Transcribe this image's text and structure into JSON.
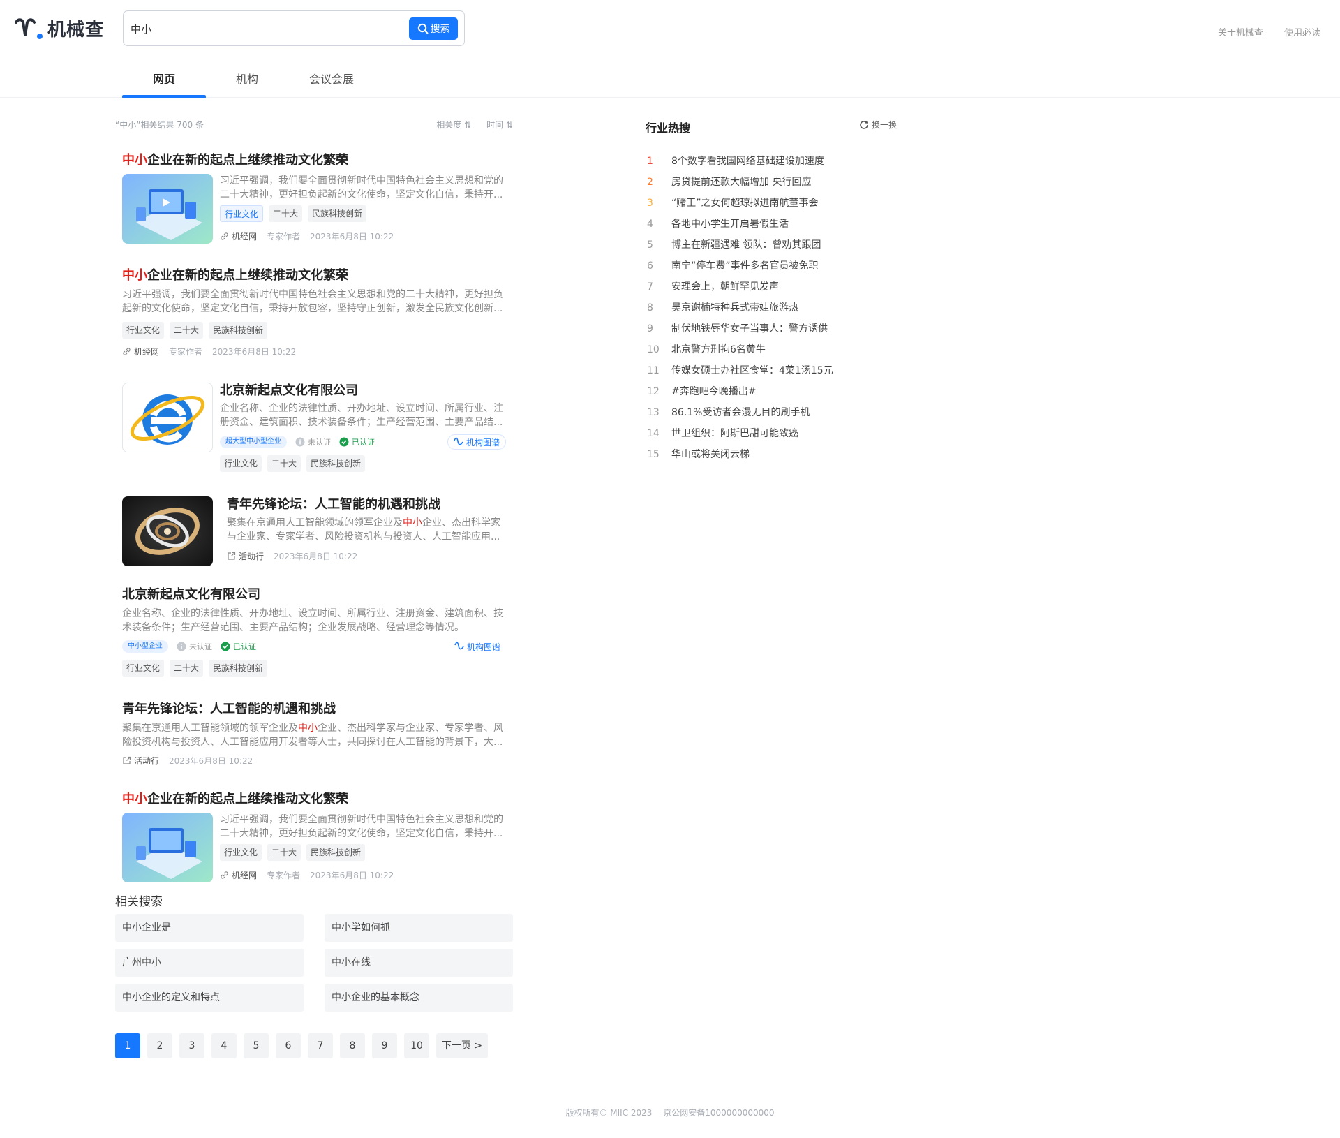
{
  "brand": {
    "name": "机械查"
  },
  "search": {
    "value": "中小",
    "button": "搜索"
  },
  "top_links": [
    "关于机械查",
    "使用必读"
  ],
  "tabs": [
    "网页",
    "机构",
    "会议会展"
  ],
  "results_meta": {
    "summary": "“中小”相关结果 700 条",
    "sort_relevance": "相关度",
    "sort_time": "时间"
  },
  "results": {
    "r1": {
      "title_hl": "中小",
      "title_rest": "企业在新的起点上继续推动文化繁荣",
      "desc": "习近平强调，我们要全面贯彻新时代中国特色社会主义思想和党的二十大精神，更好担负起新的文化使命，坚定文化自信，秉持开...",
      "tags": [
        "行业文化",
        "二十大",
        "民族科技创新"
      ],
      "source": "机经网",
      "author": "专家作者",
      "time": "2023年6月8日 10:22"
    },
    "r2": {
      "title_hl": "中小",
      "title_rest": "企业在新的起点上继续推动文化繁荣",
      "desc": "习近平强调，我们要全面贯彻新时代中国特色社会主义思想和党的二十大精神，更好担负起新的文化使命，坚定文化自信，秉持开放包容，坚持守正创新，激发全民族文化创新...",
      "tags": [
        "行业文化",
        "二十大",
        "民族科技创新"
      ],
      "source": "机经网",
      "author": "专家作者",
      "time": "2023年6月8日 10:22"
    },
    "r3": {
      "title": "北京新起点文化有限公司",
      "desc": "企业名称、企业的法律性质、开办地址、设立时间、所属行业、注册资金、建筑面积、技术装备条件；生产经营范围、主要产品结...",
      "scale": "超大型中小型企业",
      "uncert": "未认证",
      "cert": "已认证",
      "graph": "机构图谱",
      "tags": [
        "行业文化",
        "二十大",
        "民族科技创新"
      ]
    },
    "r4": {
      "title": "青年先锋论坛：人工智能的机遇和挑战",
      "desc_pre": "聚集在京通用人工智能领域的领军企业及",
      "desc_hl": "中小",
      "desc_post": "企业、杰出科学家与企业家、专家学者、风险投资机构与投资人、人工智能应用...",
      "source": "活动行",
      "time": "2023年6月8日 10:22"
    },
    "r5": {
      "title": "北京新起点文化有限公司",
      "desc": "企业名称、企业的法律性质、开办地址、设立时间、所属行业、注册资金、建筑面积、技术装备条件；生产经营范围、主要产品结构；企业发展战略、经营理念等情况。",
      "scale": "中小型企业",
      "uncert": "未认证",
      "cert": "已认证",
      "graph": "机构图谱",
      "tags": [
        "行业文化",
        "二十大",
        "民族科技创新"
      ]
    },
    "r6": {
      "title": "青年先锋论坛：人工智能的机遇和挑战",
      "desc_pre": "聚集在京通用人工智能领域的领军企业及",
      "desc_hl": "中小",
      "desc_post": "企业、杰出科学家与企业家、专家学者、风险投资机构与投资人、人工智能应用开发者等人士，共同探讨在人工智能的背景下，大...",
      "source": "活动行",
      "time": "2023年6月8日 10:22"
    },
    "r7": {
      "title_hl": "中小",
      "title_rest": "企业在新的起点上继续推动文化繁荣",
      "desc": "习近平强调，我们要全面贯彻新时代中国特色社会主义思想和党的二十大精神，更好担负起新的文化使命，坚定文化自信，秉持开...",
      "tags": [
        "行业文化",
        "二十大",
        "民族科技创新"
      ],
      "source": "机经网",
      "author": "专家作者",
      "time": "2023年6月8日 10:22"
    }
  },
  "related": {
    "title": "相关搜索",
    "items": [
      "中小企业是",
      "中小学如何抓",
      "广州中小",
      "中小在线",
      "中小企业的定义和特点",
      "中小企业的基本概念"
    ]
  },
  "pager": {
    "pages": [
      "1",
      "2",
      "3",
      "4",
      "5",
      "6",
      "7",
      "8",
      "9",
      "10"
    ],
    "next": "下一页 >",
    "current": "1"
  },
  "hot": {
    "title": "行业热搜",
    "refresh": "换一换",
    "items": [
      "8个数字看我国网络基础建设加速度",
      "房贷提前还款大幅增加 央行回应",
      "“赌王”之女何超琼拟进南航董事会",
      "各地中小学生开启暑假生活",
      "博主在新疆遇难 领队：曾劝其跟团",
      "南宁“停车费”事件多名官员被免职",
      "安理会上，朝鲜罕见发声",
      "吴京谢楠特种兵式带娃旅游热",
      "制伏地铁辱华女子当事人：警方诱供",
      "北京警方刑拘6名黄牛",
      "传媒女硕士办社区食堂：4菜1汤15元",
      "#奔跑吧今晚播出#",
      "86.1%受访者会漫无目的刷手机",
      "世卫组织：阿斯巴甜可能致癌",
      "华山或将关闭云梯"
    ]
  },
  "footer": {
    "copyright": "版权所有© MIIC 2023",
    "icp": "京公网安备1000000000000"
  },
  "colors": {
    "accent": "#1677ff",
    "highlight": "#e0211a",
    "rank1": "#f04a3a",
    "rank2": "#ff7a2d",
    "rank3": "#ffae3a"
  }
}
